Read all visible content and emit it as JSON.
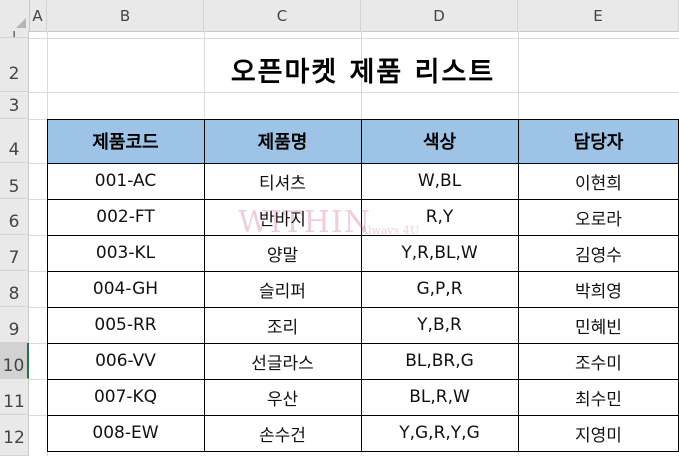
{
  "columns": [
    "A",
    "B",
    "C",
    "D",
    "E"
  ],
  "rows": [
    "1",
    "2",
    "3",
    "4",
    "5",
    "6",
    "7",
    "8",
    "9",
    "10",
    "11",
    "12"
  ],
  "selected_row": "10",
  "title": "오픈마켓 제품 리스트",
  "table": {
    "headers": [
      "제품코드",
      "제품명",
      "색상",
      "담당자"
    ],
    "data": [
      [
        "001-AC",
        "티셔츠",
        "W,BL",
        "이현희"
      ],
      [
        "002-FT",
        "반바지",
        "R,Y",
        "오로라"
      ],
      [
        "003-KL",
        "양말",
        "Y,R,BL,W",
        "김영수"
      ],
      [
        "004-GH",
        "슬리퍼",
        "G,P,R",
        "박희영"
      ],
      [
        "005-RR",
        "조리",
        "Y,B,R",
        "민혜빈"
      ],
      [
        "006-VV",
        "선글라스",
        "BL,BR,G",
        "조수미"
      ],
      [
        "007-KQ",
        "우산",
        "BL,R,W",
        "최수민"
      ],
      [
        "008-EW",
        "손수건",
        "Y,G,R,Y,G",
        "지영미"
      ]
    ]
  },
  "watermark": {
    "text": "WITHIN",
    "sub": "Always 4U"
  },
  "colors": {
    "header_fill": "#9dc3e6",
    "selected_row_marker": "#217346"
  }
}
